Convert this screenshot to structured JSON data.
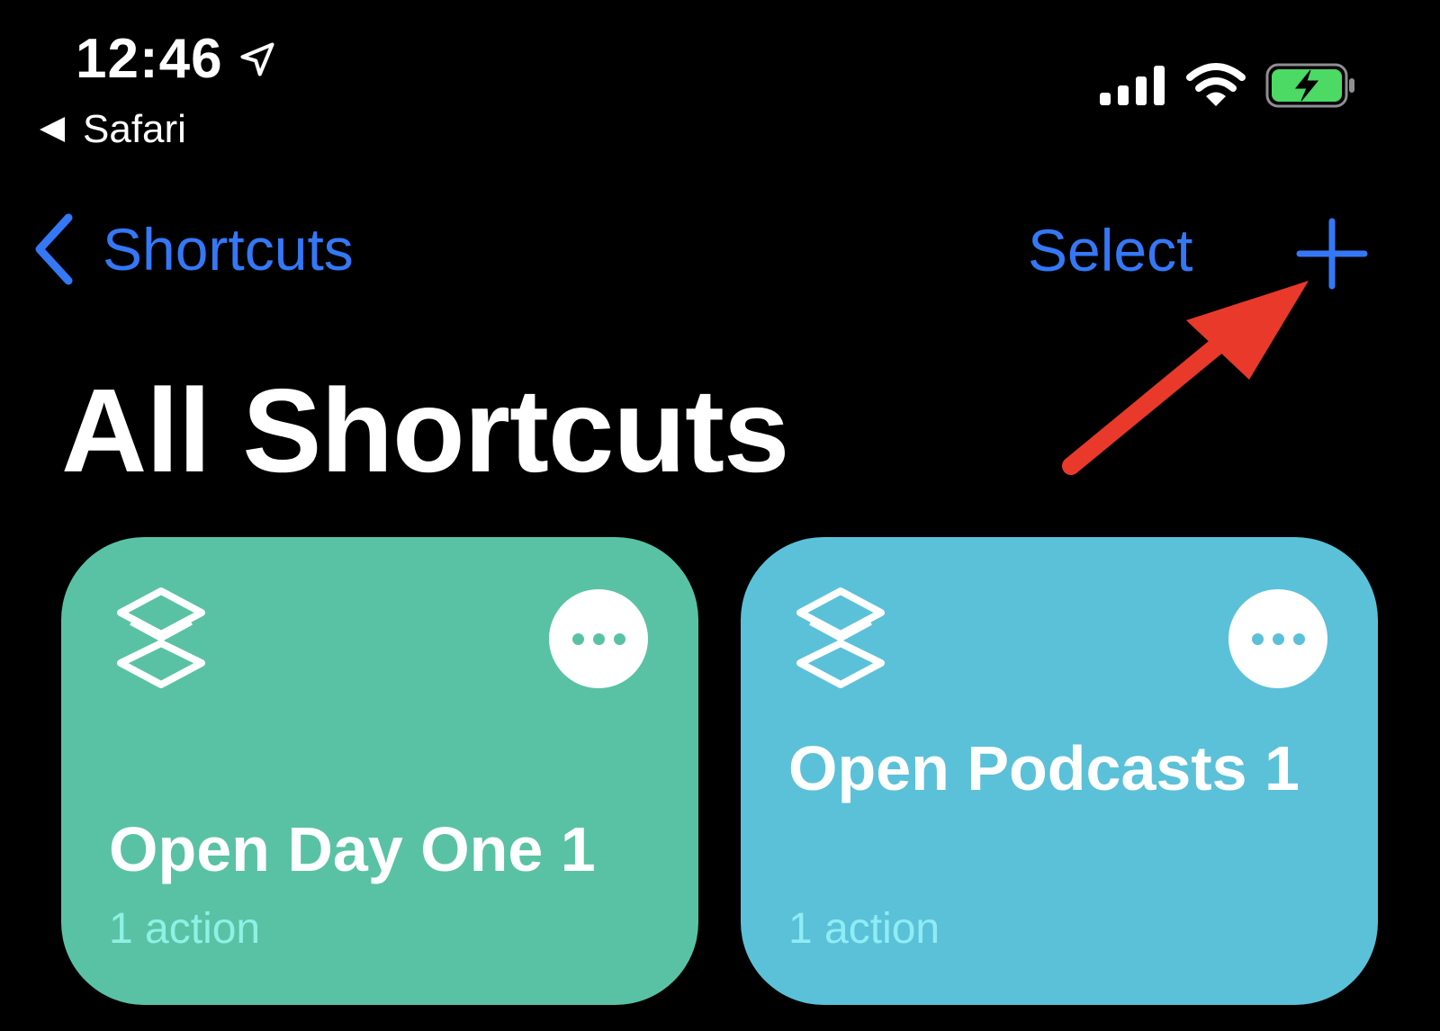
{
  "status_bar": {
    "time": "12:46",
    "back_app": "Safari",
    "battery_color": "#4cd964"
  },
  "nav": {
    "back_label": "Shortcuts",
    "select_label": "Select",
    "accent_color": "#3478f6"
  },
  "page": {
    "title": "All Shortcuts"
  },
  "annotation": {
    "arrow_color": "#e8392a"
  },
  "cards": [
    {
      "name": "Open Day One 1",
      "subtitle": "1 action",
      "color": "#5ac2a4",
      "subtitle_color": "#8ff0e4",
      "icon": "shortcut-stack-icon"
    },
    {
      "name": "Open Podcasts 1",
      "subtitle": "1 action",
      "color": "#5bc1d8",
      "subtitle_color": "#90ecf4",
      "icon": "shortcut-stack-icon"
    }
  ]
}
